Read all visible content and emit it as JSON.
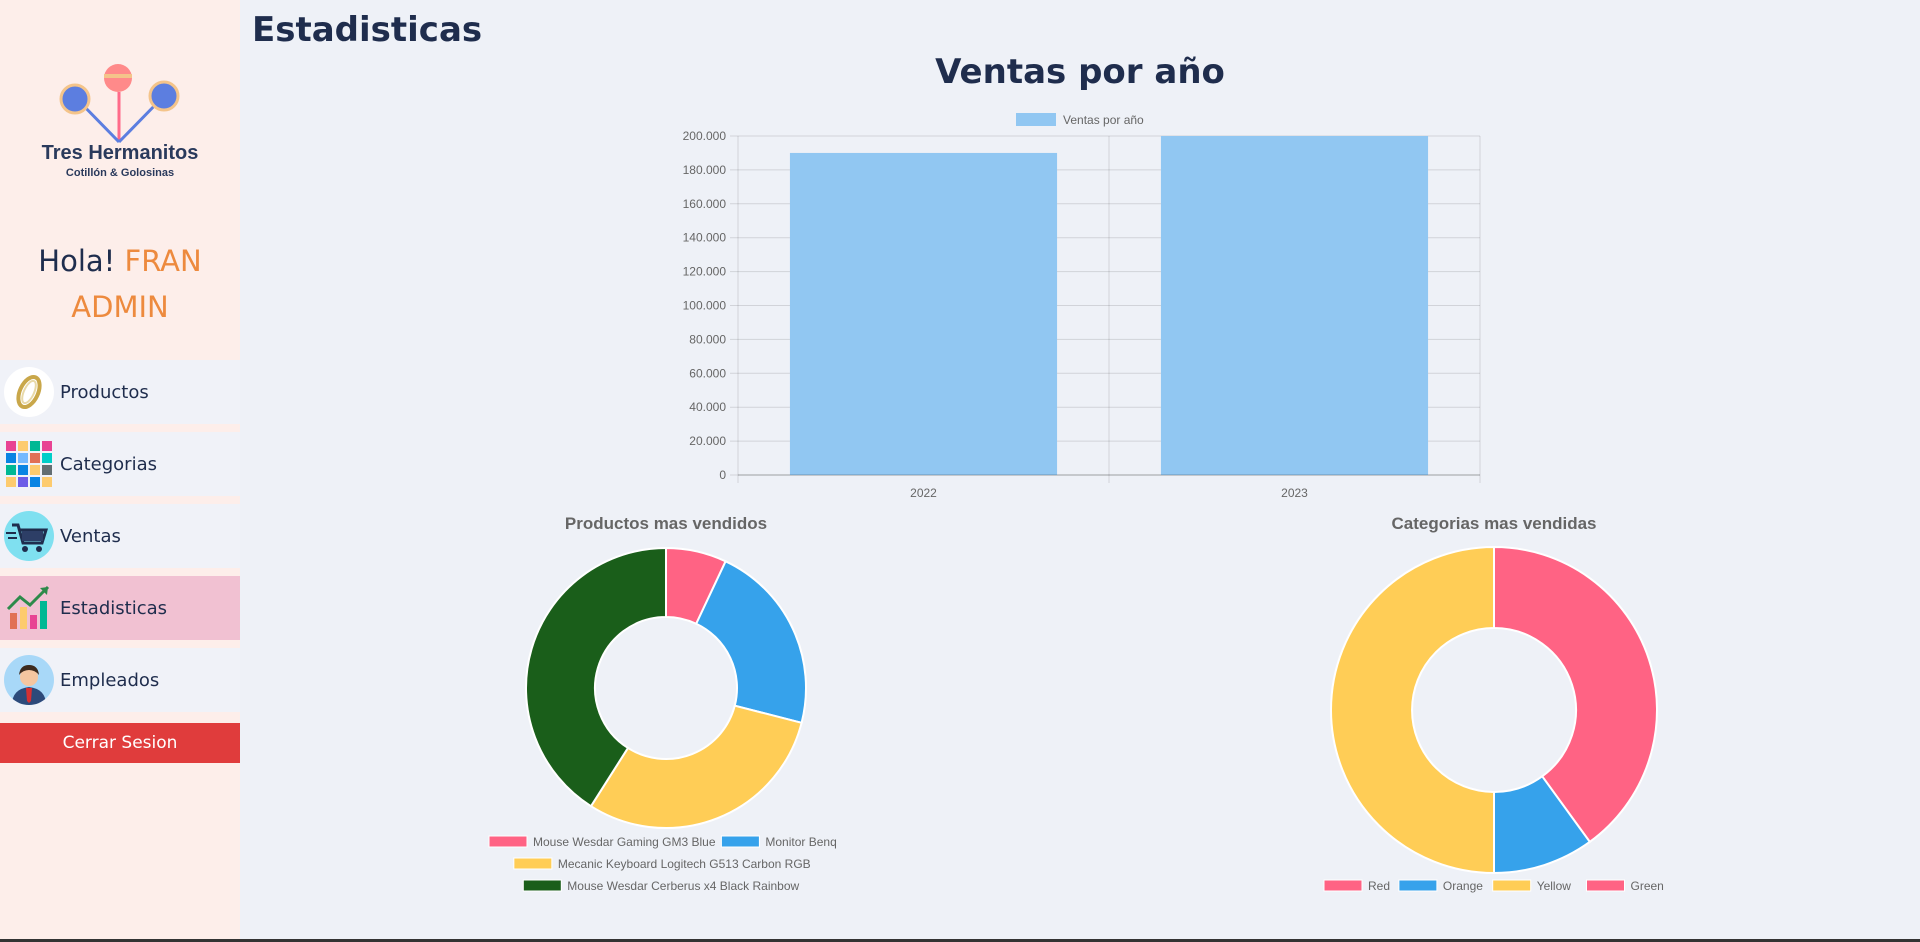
{
  "sidebar": {
    "logo": {
      "line1": "Tres Hermanitos",
      "line2": "Cotillón & Golosinas"
    },
    "greeting": {
      "prefix": "Hola!",
      "name_line1": "FRAN",
      "name_line2": "ADMIN"
    },
    "items": [
      {
        "label": "Productos",
        "icon": "ring-icon"
      },
      {
        "label": "Categorias",
        "icon": "category-grid-icon"
      },
      {
        "label": "Ventas",
        "icon": "shopping-cart-icon"
      },
      {
        "label": "Estadisticas",
        "icon": "chart-growth-icon",
        "active": true
      },
      {
        "label": "Empleados",
        "icon": "employee-avatar-icon"
      }
    ],
    "logout_label": "Cerrar Sesion"
  },
  "page_title": "Estadisticas",
  "colors": {
    "bar": "#91c7f2",
    "red": "#ff6384",
    "blue": "#36a2eb",
    "yellow": "#ffcd56",
    "green": "#1a5e1a",
    "logout": "#e03c3c",
    "accent": "#ed8a3e",
    "active_nav": "#f1c1d2"
  },
  "chart_data": [
    {
      "type": "bar",
      "title": "Ventas por año",
      "legend_label": "Ventas por año",
      "legend_position": "top",
      "categories": [
        "2022",
        "2023"
      ],
      "values": [
        190000,
        200000
      ],
      "ylim": [
        0,
        200000
      ],
      "yticks": [
        "0",
        "20.000",
        "40.000",
        "60.000",
        "80.000",
        "100.000",
        "120.000",
        "140.000",
        "160.000",
        "180.000",
        "200.000"
      ],
      "grid": true,
      "color": "#91c7f2"
    },
    {
      "type": "pie",
      "variant": "doughnut",
      "title": "Productos mas vendidos",
      "legend_position": "bottom",
      "labels": [
        "Mouse Wesdar Gaming GM3 Blue",
        "Monitor Benq",
        "Mecanic Keyboard Logitech G513 Carbon RGB",
        "Mouse Wesdar Cerberus x4 Black Rainbow"
      ],
      "values": [
        7,
        22,
        30,
        41
      ],
      "colors": [
        "#ff6384",
        "#36a2eb",
        "#ffcd56",
        "#1a5e1a"
      ]
    },
    {
      "type": "pie",
      "variant": "doughnut",
      "title": "Categorias mas vendidas",
      "legend_position": "bottom",
      "labels": [
        "Red",
        "Orange",
        "Yellow",
        "Green"
      ],
      "values": [
        40,
        10,
        50,
        0
      ],
      "colors": [
        "#ff6384",
        "#36a2eb",
        "#ffcd56",
        "#ff6384"
      ]
    }
  ]
}
